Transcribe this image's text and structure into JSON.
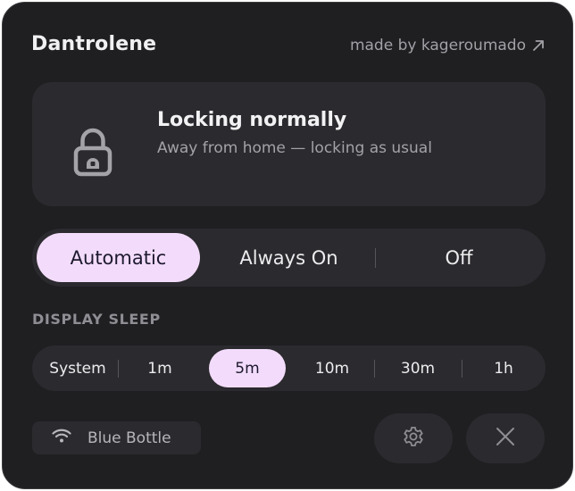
{
  "header": {
    "app_title": "Dantrolene",
    "made_by": "made by kageroumado",
    "made_by_icon": "arrow-up-right-icon"
  },
  "status": {
    "icon": "lock-icon",
    "title": "Locking normally",
    "subtitle": "Away from home — locking as usual"
  },
  "mode": {
    "options": [
      "Automatic",
      "Always On",
      "Off"
    ],
    "selected": "Automatic"
  },
  "display_sleep": {
    "label": "DISPLAY SLEEP",
    "options": [
      "System",
      "1m",
      "5m",
      "10m",
      "30m",
      "1h"
    ],
    "selected": "5m"
  },
  "footer": {
    "network_icon": "wifi-icon",
    "network_name": "Blue Bottle",
    "settings_icon": "gear-icon",
    "close_icon": "close-icon"
  },
  "colors": {
    "background": "#1f1e21",
    "card": "#2b2a2e",
    "accent": "#f3dcfb",
    "accent_text": "#1d1930",
    "muted_text": "#a3a2a7"
  }
}
